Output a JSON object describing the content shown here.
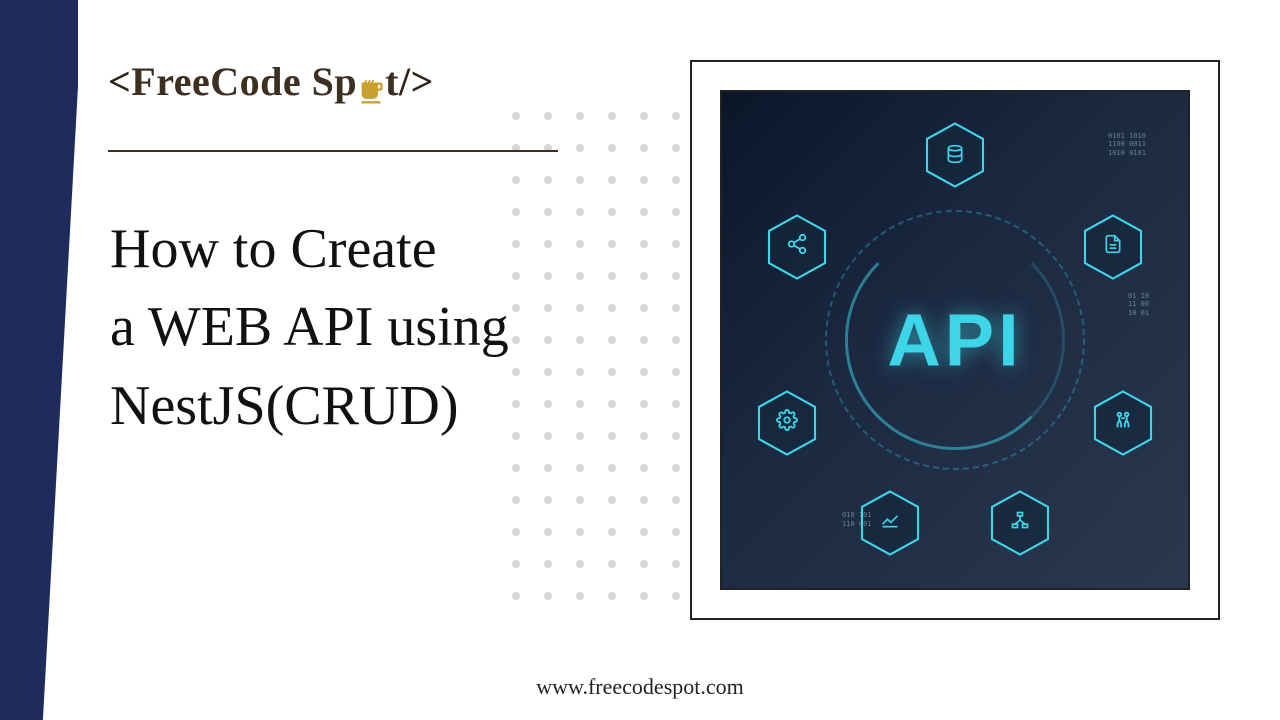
{
  "logo": {
    "open_bracket": "<",
    "text_part1": "FreeCode Sp",
    "text_part2": "t",
    "close_bracket": "/>"
  },
  "headline": {
    "line1": "How to Create",
    "line2": "a WEB API using",
    "line3": "NestJS(CRUD)"
  },
  "graphic": {
    "center_text": "API",
    "hex_icons": {
      "data": "DATA",
      "share": "share-icon",
      "document": "document-icon",
      "gear": "gear-icon",
      "people": "people-icon",
      "chart": "chart-icon",
      "network": "network-icon"
    },
    "colors": {
      "accent": "#3fd5e8",
      "bg_dark": "#0a1628",
      "navy_sidebar": "#1e2b5c"
    }
  },
  "footer": {
    "url": "www.freecodespot.com"
  }
}
